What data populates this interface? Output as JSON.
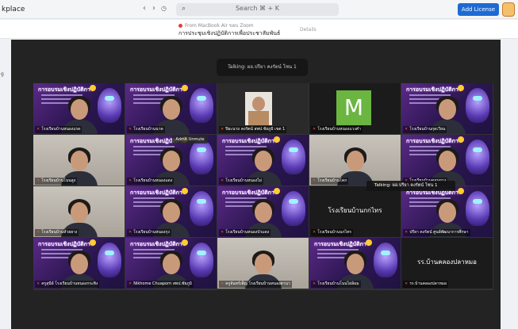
{
  "topbar": {
    "workspace": "kplace",
    "search_placeholder": "Search  ⌘ + K",
    "add_license_label": "Add License"
  },
  "notification": {
    "from": "From MacBook Air ขอบ Zoom",
    "title": "การประชุมเชิงปฏิบัติการเพื่อประชาสัมพันธ์",
    "details": "Details"
  },
  "left_panel": {
    "label": "g"
  },
  "toast": "Talking: ผอ.ปรียา คงรัตน์  โซน 1",
  "talking_overlay": "Talking: ผอ.ปรียา คงรัตน์  โซน 1",
  "active_button": "Admit Unmute",
  "tiles": [
    {
      "type": "poster",
      "name": "โรงเรียนบ้านหนองแรด",
      "title": "การอบรมเชิงปฏิบัติการ"
    },
    {
      "type": "poster",
      "name": "โรงเรียนบ้านนาค",
      "title": "การอบรมเชิงปฏิบัติการ"
    },
    {
      "type": "photo",
      "name": "ปิยะนาถ คงรัตน์ สพป.ชัยภูมิ เขต 1"
    },
    {
      "type": "letter",
      "name": "โรงเรียนบ้านหนองแวงคำ",
      "letter": "M"
    },
    {
      "type": "poster",
      "name": "โรงเรียนบ้านกุดเวียน",
      "title": "การอบรมเชิงปฏิบัติการ"
    },
    {
      "type": "room",
      "name": "โรงเรียนบ้านโนนสูง"
    },
    {
      "type": "poster",
      "name": "โรงเรียนบ้านหนองแดง",
      "title": "การอบรมเชิงปฏิบัติการ"
    },
    {
      "type": "poster",
      "name": "โรงเรียนบ้านหนองไผ่",
      "title": "การอบรมเชิงปฏิบัติการ"
    },
    {
      "type": "room",
      "name": "โรงเรียนบ้านโคก"
    },
    {
      "type": "poster",
      "name": "โรงเรียนบ้านดอนยาง",
      "title": "การอบรมเชิงปฏิบัติการ"
    },
    {
      "type": "room",
      "name": "โรงเรียนบ้านห้วยยาง"
    },
    {
      "type": "poster",
      "name": "โรงเรียนบ้านหนองกุง",
      "title": "การอบรมเชิงปฏิบัติการ"
    },
    {
      "type": "poster",
      "name": "โรงเรียนบ้านหนองบัวแดง",
      "title": "การอบรมเชิงปฏิบัติการ"
    },
    {
      "type": "text",
      "name": "โรงเรียนบ้านนกไทร",
      "big": "โรงเรียนบ้านกกไทร"
    },
    {
      "type": "poster",
      "name": "ปรียา คงรัตน์ ศูนย์พัฒนาการศึกษา",
      "title": "การอบรมเชิงปฏิบัติการ"
    },
    {
      "type": "poster",
      "name": "ครูสุนีย์ โรงเรียนบ้านหนองกระทิง",
      "title": "การอบรมเชิงปฏิบัติการ"
    },
    {
      "type": "poster",
      "name": "Nikhome Chuaporn สพป.ชัยภูมิ",
      "title": "การอบรมเชิงปฏิบัติการ"
    },
    {
      "type": "room",
      "name": "ครูจันทร์เพ็ญ โรงเรียนบ้านหนองตานา"
    },
    {
      "type": "poster",
      "name": "โรงเรียนบ้านโนนไผ่ล้อม",
      "title": "การอบรมเชิงปฏิบัติการ"
    },
    {
      "type": "text",
      "name": "รร.บ้านคลองปลาหมอ",
      "big": "รร.บ้านคลองปลาหมอ"
    }
  ]
}
